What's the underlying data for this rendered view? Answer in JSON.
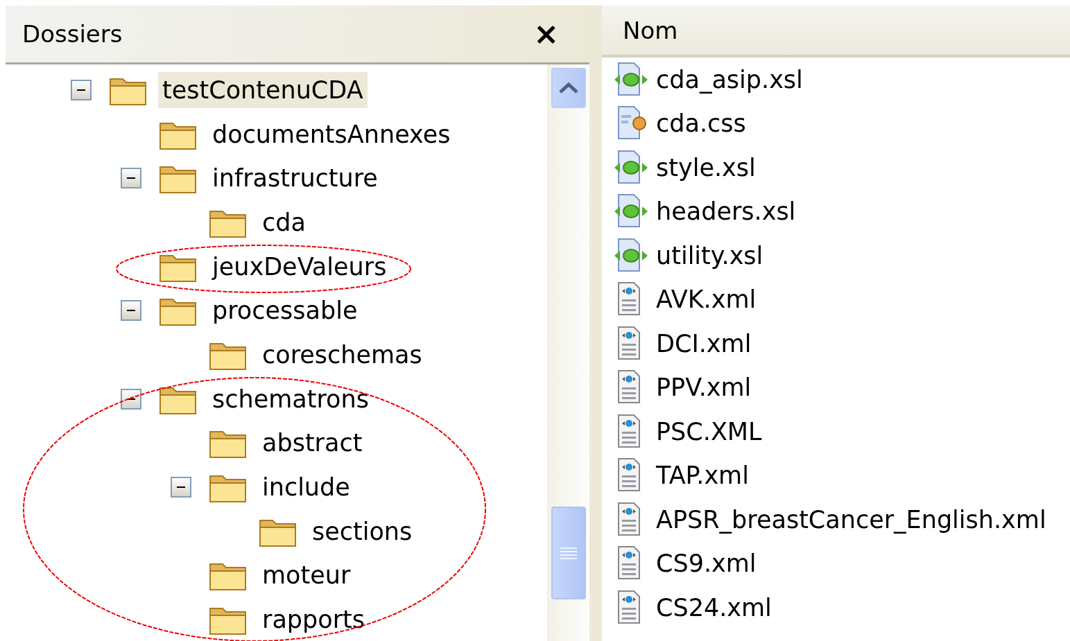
{
  "folders_pane": {
    "title": "Dossiers",
    "close": "×",
    "tree": [
      {
        "label": "testContenuCDA",
        "selected": true,
        "expanded": true,
        "children": [
          {
            "label": "documentsAnnexes",
            "selected": false
          },
          {
            "label": "infrastructure",
            "selected": false,
            "expanded": true,
            "children": [
              {
                "label": "cda",
                "selected": false
              }
            ]
          },
          {
            "label": "jeuxDeValeurs",
            "selected": false
          },
          {
            "label": "processable",
            "selected": false,
            "expanded": true,
            "children": [
              {
                "label": "coreschemas",
                "selected": false
              }
            ]
          },
          {
            "label": "schematrons",
            "selected": false,
            "expanded": true,
            "children": [
              {
                "label": "abstract",
                "selected": false
              },
              {
                "label": "include",
                "selected": false,
                "expanded": true,
                "children": [
                  {
                    "label": "sections",
                    "selected": false
                  }
                ]
              },
              {
                "label": "moteur",
                "selected": false
              },
              {
                "label": "rapports",
                "selected": false
              }
            ]
          }
        ]
      }
    ]
  },
  "files_pane": {
    "column": "Nom",
    "files": [
      {
        "name": "cda_asip.xsl",
        "kind": "xsl"
      },
      {
        "name": "cda.css",
        "kind": "css"
      },
      {
        "name": "style.xsl",
        "kind": "xsl"
      },
      {
        "name": "headers.xsl",
        "kind": "xsl"
      },
      {
        "name": "utility.xsl",
        "kind": "xsl"
      },
      {
        "name": "AVK.xml",
        "kind": "xml"
      },
      {
        "name": "DCI.xml",
        "kind": "xml"
      },
      {
        "name": "PPV.xml",
        "kind": "xml"
      },
      {
        "name": "PSC.XML",
        "kind": "xml"
      },
      {
        "name": "TAP.xml",
        "kind": "xml"
      },
      {
        "name": "APSR_breastCancer_English.xml",
        "kind": "xml"
      },
      {
        "name": "CS9.xml",
        "kind": "xml"
      },
      {
        "name": "CS24.xml",
        "kind": "xml"
      }
    ]
  }
}
